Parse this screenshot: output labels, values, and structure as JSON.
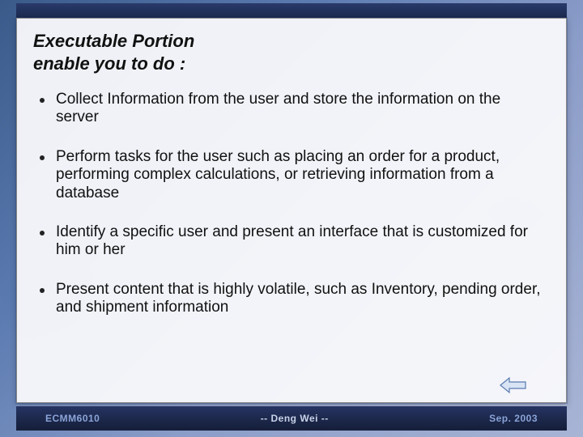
{
  "title_line1": "Executable Portion",
  "title_line2": "enable you to do :",
  "bullets": [
    "Collect Information from the user and store the information on the server",
    "Perform tasks for the user such as placing an order for a product, performing complex calculations, or retrieving information from a database",
    "Identify a specific user and present an interface that is customized for him or her",
    "Present content that is highly volatile, such as Inventory, pending order, and shipment information"
  ],
  "footer": {
    "course": "ECMM6010",
    "author": "-- Deng Wei --",
    "date": "Sep. 2003"
  }
}
